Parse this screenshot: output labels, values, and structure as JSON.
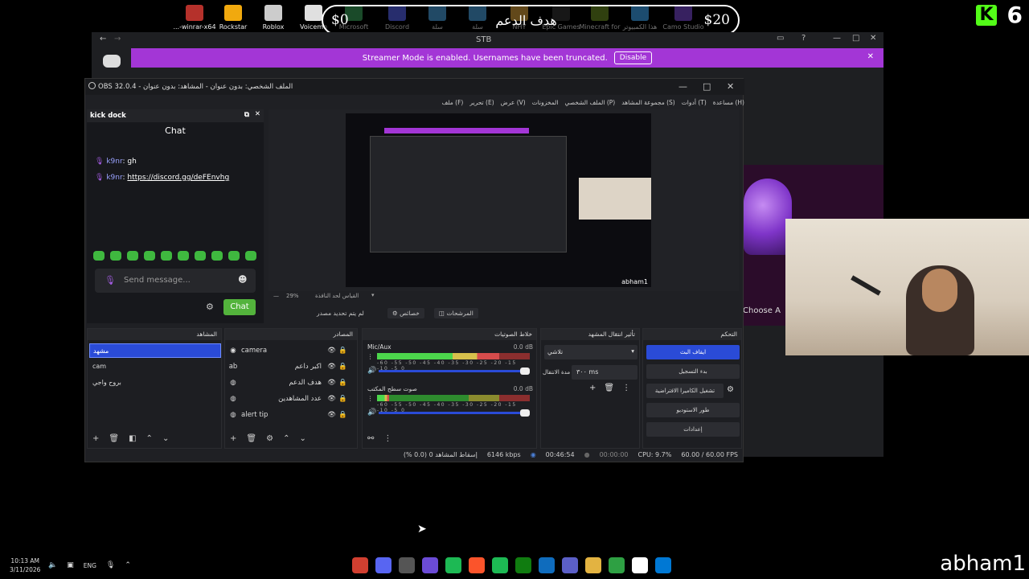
{
  "desktop_icons": [
    {
      "label": "...-winrar-x64",
      "color": "#b5312b"
    },
    {
      "label": "Rockstar",
      "color": "#f1a90e"
    },
    {
      "label": "Roblox",
      "color": "#cccccc"
    },
    {
      "label": "Voicemo",
      "color": "#e0e0e0"
    },
    {
      "label": "Microsoft",
      "color": "#3ba55c"
    },
    {
      "label": "Discord",
      "color": "#5865f2"
    },
    {
      "label": "سلة",
      "color": "#4aa3df"
    },
    {
      "label": "سلة",
      "color": "#4aa3df"
    },
    {
      "label": "NHY",
      "color": "#d9a13b"
    },
    {
      "label": "Epic Games",
      "color": "#333333"
    },
    {
      "label": "Minecraft for",
      "color": "#6b8e23"
    },
    {
      "label": "هذا الكمبيوتر",
      "color": "#3fa9f5"
    },
    {
      "label": "Camo Studio",
      "color": "#7b4bd6"
    }
  ],
  "goal": {
    "left_amount": "$0",
    "title": "هدف الدعم",
    "right_amount": "$20"
  },
  "kick": {
    "logo": "K",
    "count": "6"
  },
  "discord": {
    "window_title": "STB",
    "banner_text": "Streamer Mode is enabled. Usernames have been truncated.",
    "banner_button": "Disable",
    "choose_text": "Choose A"
  },
  "obs": {
    "title": "OBS 32.0.4 - الملف الشخصي: بدون عنوان - المشاهد: بدون عنوان",
    "menu": [
      "ملف (F)",
      "تحرير (E)",
      "عرض (V)",
      "المخزونات",
      "الملف الشخصي (P)",
      "مجموعة المشاهد (S)",
      "أدوات (T)",
      "مساعدة (H)"
    ],
    "dock": {
      "title": "kick dock",
      "chat_title": "Chat",
      "messages": [
        {
          "user": "k9nr",
          "text": "gh"
        },
        {
          "user": "k9nr",
          "text": "https://discord.gg/deFEnvhg"
        }
      ],
      "input_placeholder": "Send message...",
      "send_button": "Chat"
    },
    "preview": {
      "zoom": "29%",
      "scale_label": "القياس لحد النافذة",
      "stream_name": "abham1",
      "no_source": "لم يتم تحديد مصدر",
      "properties": "خصائص",
      "filters": "المرشحات"
    },
    "scenes": {
      "title": "المشاهد",
      "items": [
        "مشهد",
        "cam",
        "بروح واجي"
      ],
      "selected": 0
    },
    "sources": {
      "title": "المصادر",
      "items": [
        {
          "name": "camera",
          "icon": "camera-icon"
        },
        {
          "name": "اكبر داعم",
          "icon": "text-icon"
        },
        {
          "name": "هدف الدعم",
          "icon": "browser-icon"
        },
        {
          "name": "عدد المشاهدين",
          "icon": "browser-icon"
        },
        {
          "name": "alert tip",
          "icon": "browser-icon"
        }
      ]
    },
    "mixer": {
      "title": "خلاط الصوتيات",
      "channels": [
        {
          "name": "Mic/Aux",
          "db": "0.0 dB",
          "level": 0.8
        },
        {
          "name": "صوت سطح المكتب",
          "db": "0.0 dB",
          "level": 0.08
        }
      ],
      "ticks": "-60 -55 -50 -45 -40 -35 -30 -25 -20 -15 -10 -5 0"
    },
    "transitions": {
      "title": "تأثير انتقال المشهد",
      "type": "تلاشي",
      "duration_label": "مدة الانتقال",
      "duration": "٣٠٠ ms"
    },
    "controls": {
      "title": "التحكم",
      "buttons": [
        "ايقاف البث",
        "بدء التسجيل",
        "تشغيل الكاميرا الافتراضية",
        "طور الاستوديو",
        "إعدادات"
      ]
    },
    "status": {
      "dropped": "إسقاط المشاهد 0 (0.0 %)",
      "bitrate": "6146 kbps",
      "stream_time": "00:46:54",
      "rec_time": "00:00:00",
      "cpu": "CPU: 9.7%",
      "fps": "60.00 / 60.00 FPS"
    }
  },
  "taskbar": {
    "time": "10:13 AM",
    "date": "3/11/2026",
    "lang": "ENG",
    "username": "abham1",
    "apps": [
      "#d13f30",
      "#5865f2",
      "#555555",
      "#6b4bd6",
      "#1db954",
      "#fb542b",
      "#1db954",
      "#107c10",
      "#0f6cbd",
      "#5b5fc7",
      "#e3b341",
      "#2ea043",
      "#ffffff",
      "#0078d4"
    ]
  }
}
